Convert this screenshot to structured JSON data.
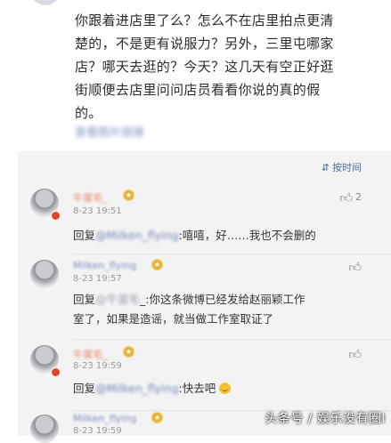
{
  "post": {
    "lines": [
      "你跟着进店里了么？怎么不在店里拍点更清",
      "楚的，不是更有说服力？另外，三里屯哪家",
      "店？哪天去逛的？今天？这几天有空正好逛",
      "街顺便去店里问问店员看看你说的真的假",
      "的。"
    ],
    "blurred_link": "查看图片链接"
  },
  "sort": {
    "label": "按时间",
    "icon": "sort-icon"
  },
  "comments": [
    {
      "username": "牛蛋毛_",
      "time": "8-23 19:51",
      "likes": "2",
      "reply_prefix": "回复",
      "mention": "@Milken_flying",
      "text": ":嘻嘻，好……我也不会删的"
    },
    {
      "username": "Milken_flying",
      "time": "8-23 19:57",
      "likes": "",
      "reply_prefix": "回复",
      "mention": "@牛蛋毛",
      "text_1": "_:你这条微博已经发给赵丽颖工作",
      "text_2": "室了，如果是造谣，就当做工作室取证了"
    },
    {
      "username": "牛蛋毛_",
      "time": "8-23 19:59",
      "likes": "",
      "reply_prefix": "回复",
      "mention": "@Milken_flying",
      "text": ":快去吧",
      "emoji": "smile-emoji"
    },
    {
      "username": "Milken_flying",
      "time": "8-23 19:59"
    }
  ],
  "watermark": "头条号 / 娱乐没有圈I",
  "colors": {
    "link": "#4a6fa5",
    "background": "#f3f3f3",
    "badge": "#e6452b"
  }
}
